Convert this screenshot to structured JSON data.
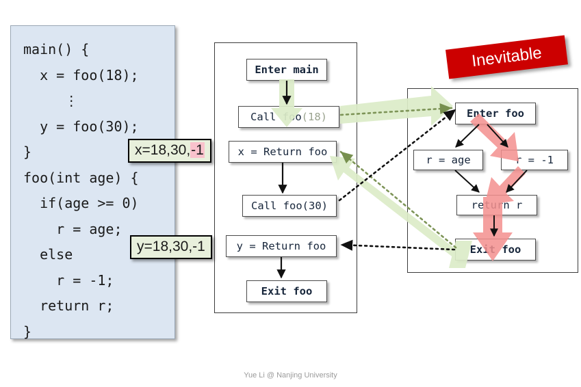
{
  "code_panel": {
    "lines": [
      "main() {",
      "  x = foo(18);",
      "     ⋮",
      "  y = foo(30);",
      "}",
      "foo(int age) {",
      "  if(age >= 0)",
      "    r = age;",
      "  else",
      "    r = -1;",
      "  return r;",
      "}"
    ],
    "text": "main() {\n  x = foo(18);\n     ⋮\n  y = foo(30);\n}\nfoo(int age) {\n  if(age >= 0)\n    r = age;\n  else\n    r = -1;\n  return r;\n}",
    "bg_color": "#dce6f2"
  },
  "callouts": {
    "x": {
      "prefix": "x=18,30,",
      "highlight": "-1",
      "full": "x=18,30,-1",
      "bg": "#e8f0dc",
      "highlight_bg": "#f9c2cc"
    },
    "y": {
      "full": "y=18,30,-1",
      "bg": "#e8f0dc"
    }
  },
  "banner": {
    "label": "Inevitable",
    "bg": "#cc0000",
    "text_color": "#ffffff"
  },
  "main_flow": {
    "nodes": [
      {
        "id": "enter-main",
        "label": "Enter main",
        "bold": true
      },
      {
        "id": "call-foo-18",
        "label": "Call foo",
        "suffix": "(18)",
        "bold": false
      },
      {
        "id": "x-return-foo",
        "label": "x = Return foo",
        "bold": false
      },
      {
        "id": "call-foo-30",
        "label": "Call foo(30)",
        "bold": false
      },
      {
        "id": "y-return-foo",
        "label": "y = Return foo",
        "bold": false
      },
      {
        "id": "exit-main",
        "label": "Exit foo",
        "bold": true
      }
    ]
  },
  "foo_flow": {
    "nodes": [
      {
        "id": "enter-foo",
        "label": "Enter foo",
        "bold": true
      },
      {
        "id": "r-age",
        "label": "r = age",
        "bold": false
      },
      {
        "id": "r-neg1",
        "label": "r = -1",
        "bold": false
      },
      {
        "id": "return-r",
        "label": "return r",
        "bold": false
      },
      {
        "id": "exit-foo",
        "label": "Exit foo",
        "bold": true
      }
    ]
  },
  "highlight_colors": {
    "green_arrow": "#dcecc8",
    "green_arrow_stroke": "#8aa06a",
    "red_arrow": "#f4908f",
    "red_arrow_stroke": "#e87a79"
  },
  "footer": {
    "credit": "Yue Li @ Nanjing University"
  }
}
